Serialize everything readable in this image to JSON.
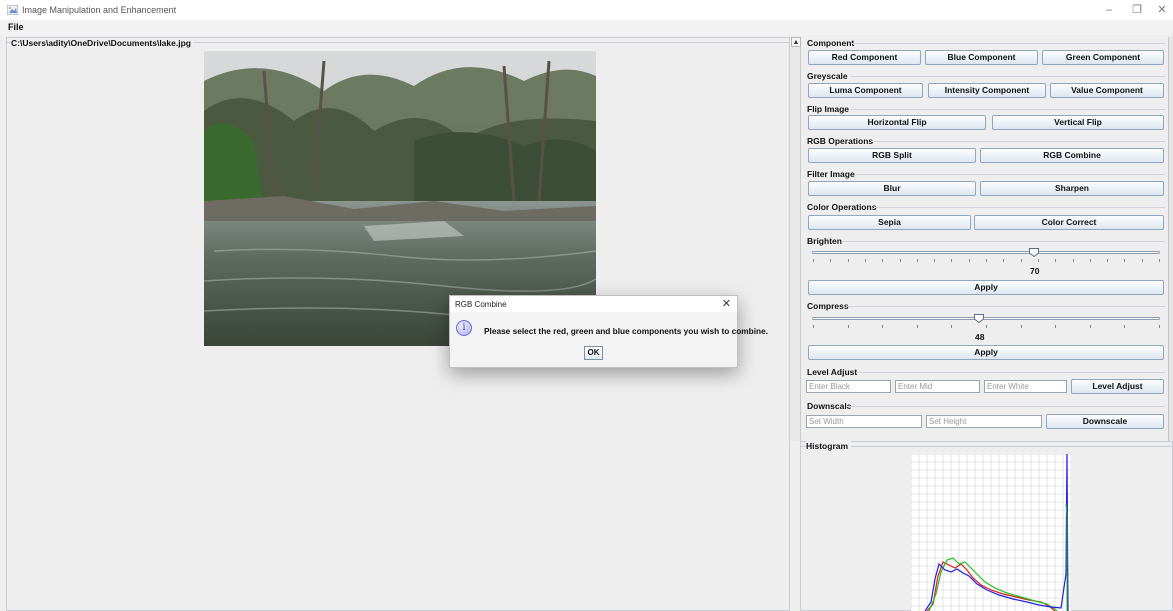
{
  "window": {
    "title": "Image Manipulation and Enhancement"
  },
  "menu": {
    "file": "File"
  },
  "image_panel": {
    "path": "C:\\Users\\adity\\OneDrive\\Documents\\lake.jpg"
  },
  "component": {
    "title": "Component",
    "red": "Red Component",
    "blue": "Blue Component",
    "green": "Green Component"
  },
  "greyscale": {
    "title": "Greyscale",
    "luma": "Luma Component",
    "intensity": "Intensity Component",
    "value": "Value Component"
  },
  "flip": {
    "title": "Flip Image",
    "horizontal": "Horizontal Flip",
    "vertical": "Vertical Flip"
  },
  "rgb_ops": {
    "title": "RGB Operations",
    "split": "RGB Split",
    "combine": "RGB Combine"
  },
  "filter": {
    "title": "Filter Image",
    "blur": "Blur",
    "sharpen": "Sharpen"
  },
  "color_ops": {
    "title": "Color Operations",
    "sepia": "Sepia",
    "color_correct": "Color Correct"
  },
  "brighten": {
    "title": "Brighten",
    "value": "70",
    "apply": "Apply"
  },
  "compress": {
    "title": "Compress",
    "value": "48",
    "apply": "Apply"
  },
  "level_adjust": {
    "title": "Level Adjust",
    "black_placeholder": "Enter Black",
    "mid_placeholder": "Enter Mid",
    "white_placeholder": "Enter White",
    "button": "Level Adjust"
  },
  "downscale": {
    "title": "Downscale",
    "width_placeholder": "Set Width",
    "height_placeholder": "Set Height",
    "button": "Downscale"
  },
  "histogram": {
    "title": "Histogram"
  },
  "dialog": {
    "title": "RGB Combine",
    "message": "Please select the red, green and blue components you wish to combine.",
    "ok": "OK",
    "icon": "info-icon"
  },
  "colors": {
    "button_border": "#8fa6bf",
    "hist_red": "#e02020",
    "hist_green": "#20c020",
    "hist_blue": "#2020e0"
  }
}
